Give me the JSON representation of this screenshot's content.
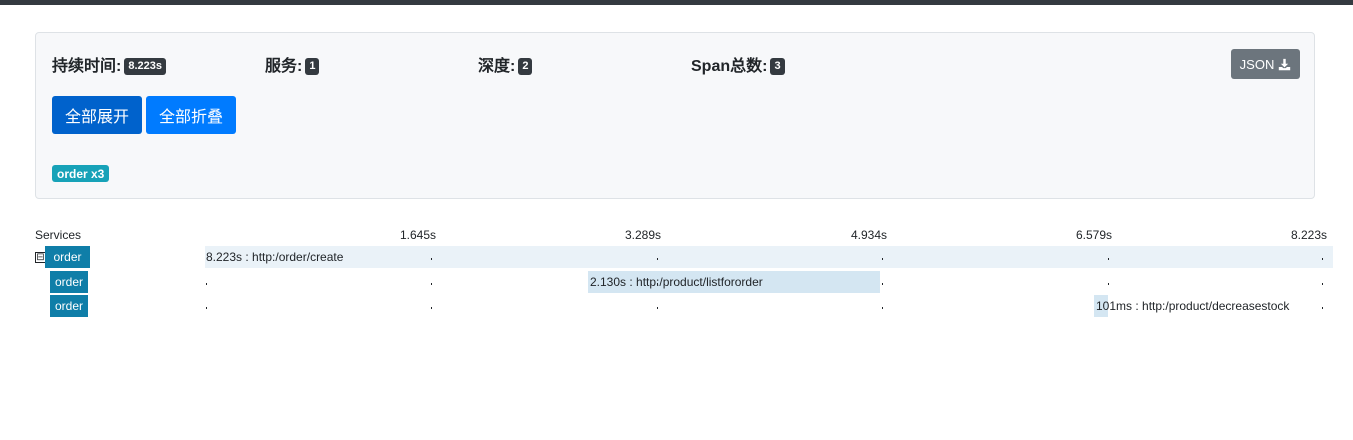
{
  "summary": {
    "duration_label": "持续时间:",
    "duration_value": "8.223s",
    "services_label": "服务:",
    "services_value": "1",
    "depth_label": "深度:",
    "depth_value": "2",
    "span_count_label": "Span总数:",
    "span_count_value": "3",
    "json_button_label": "JSON",
    "json_button_icon": "download-icon",
    "expand_all_label": "全部展开",
    "collapse_all_label": "全部折叠",
    "service_badge": "order x3"
  },
  "timeline": {
    "header_label": "Services",
    "ticks": [
      "1.645s",
      "3.289s",
      "4.934s",
      "6.579s",
      "8.223s"
    ],
    "toggle_symbol": "⊟",
    "rows": [
      {
        "service": "order",
        "span_label": "8.223s : http:/order/create",
        "duration": "8.223s"
      },
      {
        "service": "order",
        "span_label": "2.130s : http:/product/listfororder",
        "duration": "2.130s"
      },
      {
        "service": "order",
        "span_label": "101ms : http:/product/decreasestock",
        "duration": "101ms"
      }
    ]
  }
}
